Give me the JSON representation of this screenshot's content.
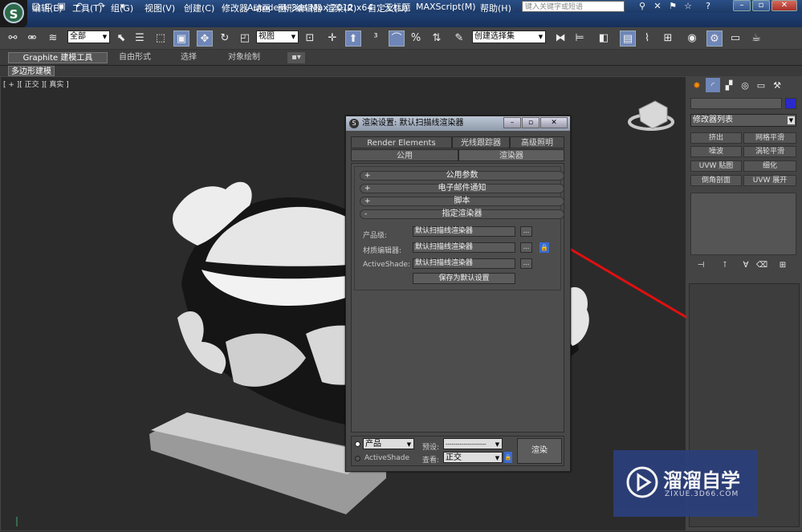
{
  "app": {
    "title": "Autodesk 3ds Max  2012 x64",
    "doc_title": "无标题",
    "search_placeholder": "键入关键字或短语",
    "logo": "S"
  },
  "menu": [
    "编辑(E)",
    "工具(T)",
    "组(G)",
    "视图(V)",
    "创建(C)",
    "修改器",
    "动画",
    "图形编辑器",
    "渲染(R)",
    "自定义(U)",
    "MAXScript(M)",
    "帮助(H)"
  ],
  "toolbar": {
    "selection_filter": "全部",
    "ref_coord": "视图",
    "named_selection": "创建选择集"
  },
  "ribbon": {
    "tabs": [
      "Graphite 建模工具",
      "自由形式",
      "选择",
      "对象绘制"
    ],
    "subtab": "多边形建模"
  },
  "viewport": {
    "label": "[ + ][ 正交 ][ 真实 ]"
  },
  "command_panel": {
    "modifier_list": "修改器列表",
    "buttons": [
      "挤出",
      "网格平滑",
      "噪波",
      "涡轮平滑",
      "UVW 贴图",
      "细化",
      "倒角剖面",
      "UVW 展开"
    ]
  },
  "dialog": {
    "title": "渲染设置: 默认扫描线渲染器",
    "tabs_row1": [
      "Render Elements",
      "光线跟踪器",
      "高级照明"
    ],
    "tabs_row2": [
      "公用",
      "渲染器"
    ],
    "rollouts": [
      {
        "sign": "+",
        "label": "公用参数"
      },
      {
        "sign": "+",
        "label": "电子邮件通知"
      },
      {
        "sign": "+",
        "label": "脚本"
      },
      {
        "sign": "-",
        "label": "指定渲染器"
      }
    ],
    "fields": [
      {
        "label": "产品级:",
        "value": "默认扫描线渲染器"
      },
      {
        "label": "材质编辑器:",
        "value": "默认扫描线渲染器"
      },
      {
        "label": "ActiveShade:",
        "value": "默认扫描线渲染器"
      }
    ],
    "browse_label": "...",
    "save_default": "保存为默认设置",
    "bottom": {
      "mode_product": "产品",
      "mode_activeshade": "ActiveShade",
      "preset_label": "预设:",
      "preset_value": "--------------------",
      "view_label": "查看:",
      "view_value": "正交",
      "render_button": "渲染"
    }
  },
  "watermark": {
    "brand": "溜溜自学",
    "url": "ZIXUE.3D66.COM"
  },
  "colors": {
    "annotation": "#e01010",
    "watermark_bg": "#2c3f7a"
  }
}
